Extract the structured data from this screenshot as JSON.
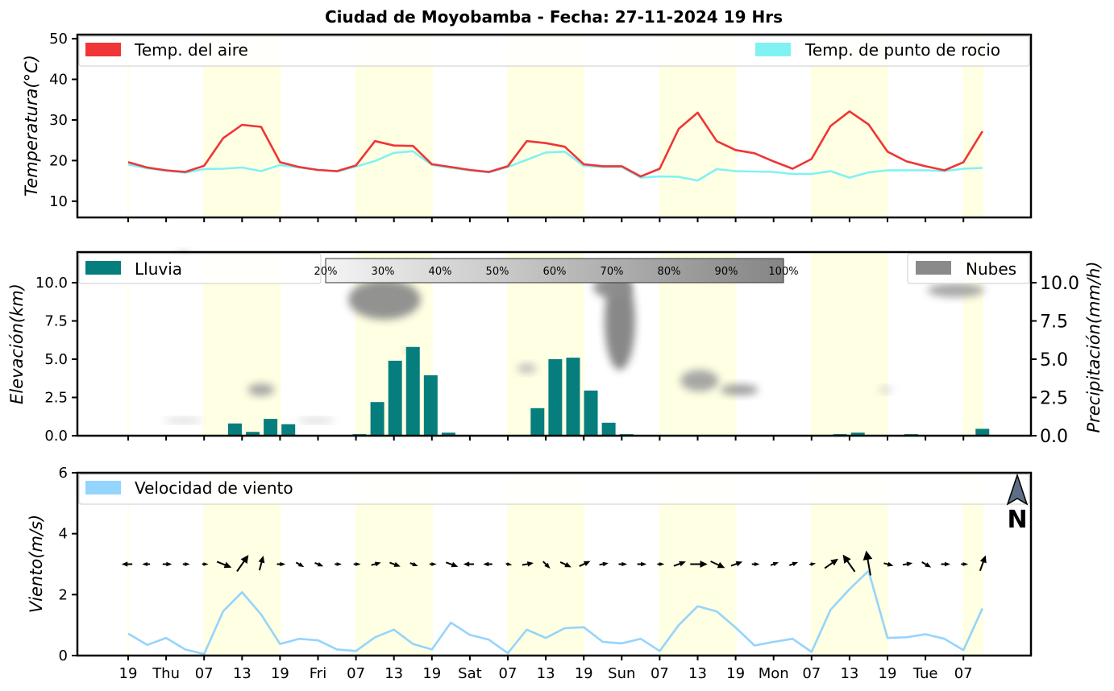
{
  "title": "Ciudad de Moyobamba   -   Fecha: 27-11-2024 19 Hrs",
  "x_tick_labels": [
    "19",
    "Thu",
    "07",
    "13",
    "19",
    "Fri",
    "07",
    "13",
    "19",
    "Sat",
    "07",
    "13",
    "19",
    "Sun",
    "07",
    "13",
    "19",
    "Mon",
    "07",
    "13",
    "19",
    "Tue",
    "07"
  ],
  "daylight_bands": [
    [
      0,
      0
    ],
    [
      4,
      8
    ],
    [
      12,
      16
    ],
    [
      20,
      24
    ],
    [
      28,
      32
    ],
    [
      36,
      40
    ],
    [
      44,
      45
    ]
  ],
  "colors": {
    "air": "#ef3535",
    "dew": "#80f2f4",
    "rain": "#077e7e",
    "clouds": "#8a8a8a",
    "wind": "#95d4fc",
    "daylight": "#ffffe3",
    "north_arrow": "#5d6f86"
  },
  "north_label": "N",
  "north_icon": "north-arrow-icon",
  "chart_data": [
    {
      "type": "line",
      "ylabel": "Temperatura(°C)",
      "ylim": [
        6,
        51
      ],
      "yticks": [
        10,
        20,
        30,
        40,
        50
      ],
      "legend_location": "top",
      "x": [
        0,
        1,
        2,
        3,
        4,
        5,
        6,
        7,
        8,
        9,
        10,
        11,
        12,
        13,
        14,
        15,
        16,
        17,
        18,
        19,
        20,
        21,
        22,
        23,
        24,
        25,
        26,
        27,
        28,
        29,
        30,
        31,
        32,
        33,
        34,
        35,
        36,
        37,
        38,
        39,
        40,
        41,
        42,
        43,
        44,
        45
      ],
      "series": [
        {
          "name": "Temp. del aire",
          "values": [
            19.6,
            18.3,
            17.6,
            17.2,
            18.7,
            25.5,
            28.8,
            28.3,
            19.6,
            18.4,
            17.7,
            17.4,
            18.8,
            24.8,
            23.7,
            23.6,
            19.1,
            18.4,
            17.7,
            17.2,
            18.6,
            24.8,
            24.3,
            23.4,
            19.1,
            18.6,
            18.6,
            16.1,
            18.0,
            27.8,
            31.8,
            24.8,
            22.6,
            21.8,
            19.8,
            18.0,
            20.4,
            28.5,
            32.1,
            28.9,
            22.2,
            19.8,
            18.6,
            17.6,
            19.6,
            27.2
          ]
        },
        {
          "name": "Temp. de punto de rocio",
          "values": [
            19.0,
            18.1,
            17.5,
            17.0,
            17.9,
            18.0,
            18.3,
            17.4,
            18.9,
            18.3,
            17.7,
            17.3,
            18.5,
            19.9,
            21.9,
            22.3,
            18.9,
            18.2,
            17.6,
            17.1,
            18.4,
            20.2,
            22.0,
            22.2,
            18.7,
            18.4,
            18.4,
            15.8,
            16.1,
            16.0,
            15.1,
            17.9,
            17.4,
            17.3,
            17.2,
            16.7,
            16.7,
            17.4,
            15.8,
            17.1,
            17.6,
            17.6,
            17.6,
            17.4,
            18.0,
            18.2
          ]
        }
      ]
    },
    {
      "type": "bar",
      "ylabel": "Elevación(km)",
      "ylabel_right": "Precipitación(mm/h)",
      "ylim": [
        0,
        12
      ],
      "yticks": [
        "0.0",
        "2.5",
        "5.0",
        "7.5",
        "10.0"
      ],
      "legend_location": "top",
      "series": [
        {
          "name": "Lluvia",
          "values": [
            0,
            0.05,
            0,
            0,
            0,
            0,
            0.8,
            0.25,
            1.1,
            0.75,
            0,
            0,
            0.05,
            0.1,
            2.2,
            4.9,
            5.8,
            3.95,
            0.2,
            0,
            0,
            0,
            0.05,
            1.8,
            5.0,
            5.1,
            2.95,
            0.85,
            0.1,
            0,
            0,
            0,
            0.05,
            0,
            0,
            0,
            0,
            0,
            0,
            0,
            0.1,
            0.2,
            0,
            0,
            0.1,
            0.05,
            0,
            0.05,
            0.45
          ]
        },
        {
          "name": "Nubes"
        }
      ],
      "colorbar_labels": [
        "20%",
        "30%",
        "40%",
        "50%",
        "60%",
        "70%",
        "80%",
        "90%",
        "100%"
      ],
      "cloud_patches": [
        {
          "x": 13.5,
          "y": 8.9,
          "rx": 1.9,
          "ry": 1.3,
          "coverage": 0.9
        },
        {
          "x": 25.9,
          "y": 7.5,
          "rx": 0.8,
          "ry": 3.2,
          "coverage": 1.0
        },
        {
          "x": 25.5,
          "y": 9.7,
          "rx": 1.0,
          "ry": 0.7,
          "coverage": 0.9
        },
        {
          "x": 7.0,
          "y": 3.0,
          "rx": 0.7,
          "ry": 0.4,
          "coverage": 0.7
        },
        {
          "x": 2.9,
          "y": 1.0,
          "rx": 1.0,
          "ry": 0.15,
          "coverage": 0.3
        },
        {
          "x": 9.9,
          "y": 1.0,
          "rx": 1.0,
          "ry": 0.15,
          "coverage": 0.3
        },
        {
          "x": 14.7,
          "y": 5.6,
          "rx": 0.2,
          "ry": 0.15,
          "coverage": 0.4
        },
        {
          "x": 21.0,
          "y": 4.4,
          "rx": 0.5,
          "ry": 0.3,
          "coverage": 0.5
        },
        {
          "x": 30.1,
          "y": 3.6,
          "rx": 1.0,
          "ry": 0.7,
          "coverage": 0.7
        },
        {
          "x": 32.2,
          "y": 3.0,
          "rx": 1.0,
          "ry": 0.35,
          "coverage": 0.8
        },
        {
          "x": 39.9,
          "y": 3.0,
          "rx": 0.35,
          "ry": 0.2,
          "coverage": 0.3
        },
        {
          "x": 43.6,
          "y": 9.5,
          "rx": 1.5,
          "ry": 0.45,
          "coverage": 0.7
        },
        {
          "x": 2.9,
          "y": 11.9,
          "rx": 0.3,
          "ry": 0.2,
          "coverage": 0.3
        }
      ]
    },
    {
      "type": "line",
      "ylabel": "Viento(m/s)",
      "ylim": [
        0,
        6
      ],
      "yticks": [
        0,
        2,
        4,
        6
      ],
      "legend_location": "top-left",
      "x": [
        0,
        1,
        2,
        3,
        4,
        5,
        6,
        7,
        8,
        9,
        10,
        11,
        12,
        13,
        14,
        15,
        16,
        17,
        18,
        19,
        20,
        21,
        22,
        23,
        24,
        25,
        26,
        27,
        28,
        29,
        30,
        31,
        32,
        33,
        34,
        35,
        36,
        37,
        38,
        39,
        40,
        41,
        42,
        43,
        44,
        45
      ],
      "series": [
        {
          "name": "Velocidad de viento",
          "values": [
            0.72,
            0.35,
            0.58,
            0.2,
            0.05,
            1.45,
            2.08,
            1.35,
            0.38,
            0.55,
            0.5,
            0.2,
            0.15,
            0.6,
            0.85,
            0.38,
            0.2,
            1.08,
            0.68,
            0.52,
            0.08,
            0.85,
            0.58,
            0.9,
            0.93,
            0.45,
            0.4,
            0.55,
            0.15,
            1.0,
            1.62,
            1.45,
            0.92,
            0.33,
            0.45,
            0.55,
            0.12,
            1.5,
            2.18,
            2.78,
            0.58,
            0.6,
            0.7,
            0.55,
            0.18,
            1.55
          ]
        }
      ],
      "wind_barbs": {
        "y": 3,
        "angles_deg": [
          180,
          180,
          0,
          0,
          0,
          22,
          -55,
          -75,
          0,
          30,
          22,
          0,
          0,
          -15,
          20,
          22,
          0,
          20,
          180,
          180,
          10,
          -10,
          45,
          25,
          -25,
          -10,
          0,
          0,
          0,
          -20,
          0,
          25,
          -20,
          0,
          -20,
          -20,
          -10,
          -35,
          -125,
          -100,
          15,
          -10,
          30,
          0,
          0,
          -70
        ],
        "magnitudes": [
          0.7,
          0.3,
          0.5,
          0.2,
          0.1,
          1.4,
          2.0,
          1.3,
          0.4,
          0.5,
          0.5,
          0.2,
          0.2,
          0.6,
          0.8,
          0.4,
          0.2,
          1.0,
          0.7,
          0.5,
          0.1,
          0.8,
          0.6,
          0.9,
          0.9,
          0.5,
          0.4,
          0.5,
          0.2,
          1.0,
          1.6,
          1.4,
          0.9,
          0.3,
          0.4,
          0.5,
          0.1,
          1.5,
          2.1,
          2.7,
          0.6,
          0.6,
          0.7,
          0.5,
          0.2,
          1.5
        ]
      }
    }
  ]
}
